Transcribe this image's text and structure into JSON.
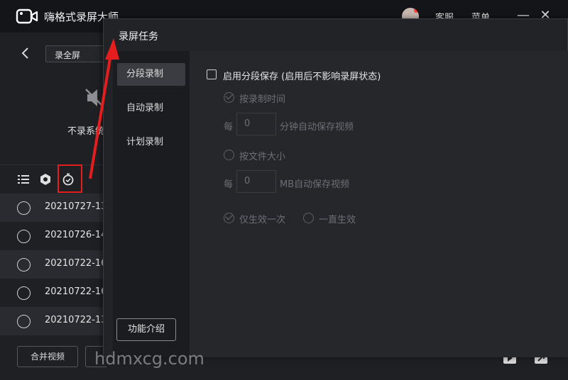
{
  "app": {
    "title": "嗨格式录屏大师",
    "links": [
      "客服",
      "菜单"
    ],
    "mode": "录全屏",
    "mute_label": "不录系统声音"
  },
  "list_toolbar": {
    "icons": [
      "list-icon",
      "settings-hex-icon",
      "timer-icon"
    ]
  },
  "recordings": [
    "20210727-13",
    "20210726-14",
    "20210722-16",
    "20210722-16",
    "20210722-13"
  ],
  "bottom": {
    "merge_label": "合并视频"
  },
  "dialog": {
    "title": "录屏任务",
    "sidebar": [
      "分段录制",
      "自动录制",
      "计划录制"
    ],
    "intro_label": "功能介绍",
    "enable_label": "启用分段保存 (启用后不影响录屏状态)",
    "by_time_label": "按录制时间",
    "every_label": "每",
    "minutes_value": "0",
    "minutes_suffix": "分钟自动保存视频",
    "by_size_label": "按文件大小",
    "mb_value": "0",
    "mb_suffix": "MB自动保存视频",
    "once_label": "仅生效一次",
    "always_label": "一直生效"
  },
  "watermark": "hdmxcg.com",
  "colors": {
    "highlight": "#e41e1e",
    "background": "#1f2024",
    "dialog": "#26272b"
  }
}
